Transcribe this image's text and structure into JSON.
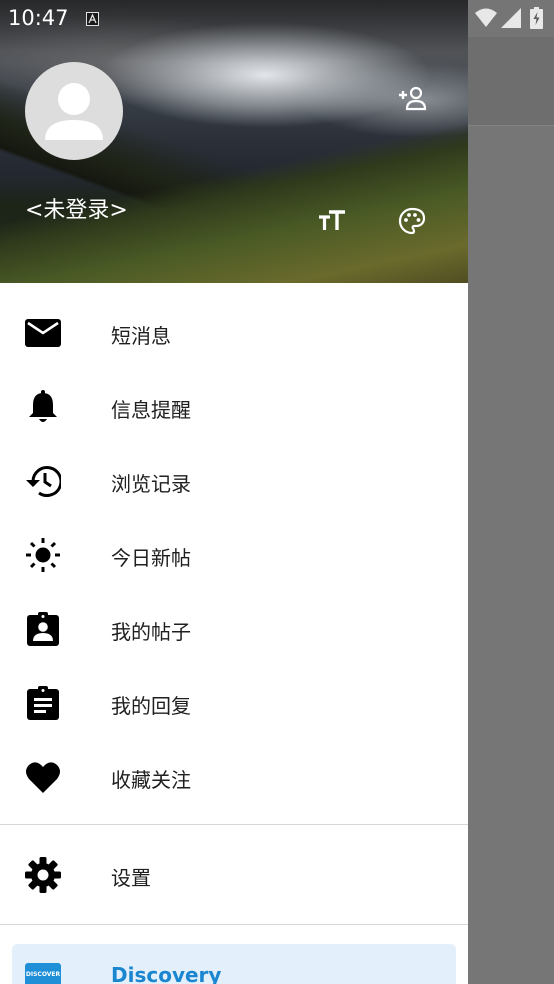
{
  "status_bar": {
    "time": "10:47",
    "notification_icon": "a-notification-icon",
    "wifi_icon": "wifi-icon",
    "signal_icon": "cell-signal-icon",
    "battery_icon": "battery-charging-icon"
  },
  "drawer": {
    "header": {
      "avatar_icon": "account-circle-icon",
      "login_status": "<未登录>",
      "add_user_icon": "add-user-icon",
      "text_size_icon": "text-size-icon",
      "palette_icon": "palette-icon"
    },
    "menu": [
      {
        "id": "messages",
        "icon": "mail-icon",
        "label": "短消息"
      },
      {
        "id": "notifications",
        "icon": "bell-icon",
        "label": "信息提醒"
      },
      {
        "id": "history",
        "icon": "history-icon",
        "label": "浏览记录"
      },
      {
        "id": "today",
        "icon": "sun-icon",
        "label": "今日新帖"
      },
      {
        "id": "my-posts",
        "icon": "account-box-icon",
        "label": "我的帖子"
      },
      {
        "id": "my-replies",
        "icon": "clipboard-text-icon",
        "label": "我的回复"
      },
      {
        "id": "favorites",
        "icon": "heart-icon",
        "label": "收藏关注"
      }
    ],
    "settings": {
      "icon": "gear-icon",
      "label": "设置"
    },
    "discovery": {
      "icon": "discover-card-icon",
      "icon_text": "DISCOVER",
      "label": "Discovery"
    }
  },
  "colors": {
    "scrim": "#757575",
    "drawer_bg": "#ffffff",
    "menu_text": "#1f1f1f",
    "divider": "#d6d6d6",
    "discovery_bg": "#e3f0fb",
    "discovery_accent": "#1a86cf"
  }
}
